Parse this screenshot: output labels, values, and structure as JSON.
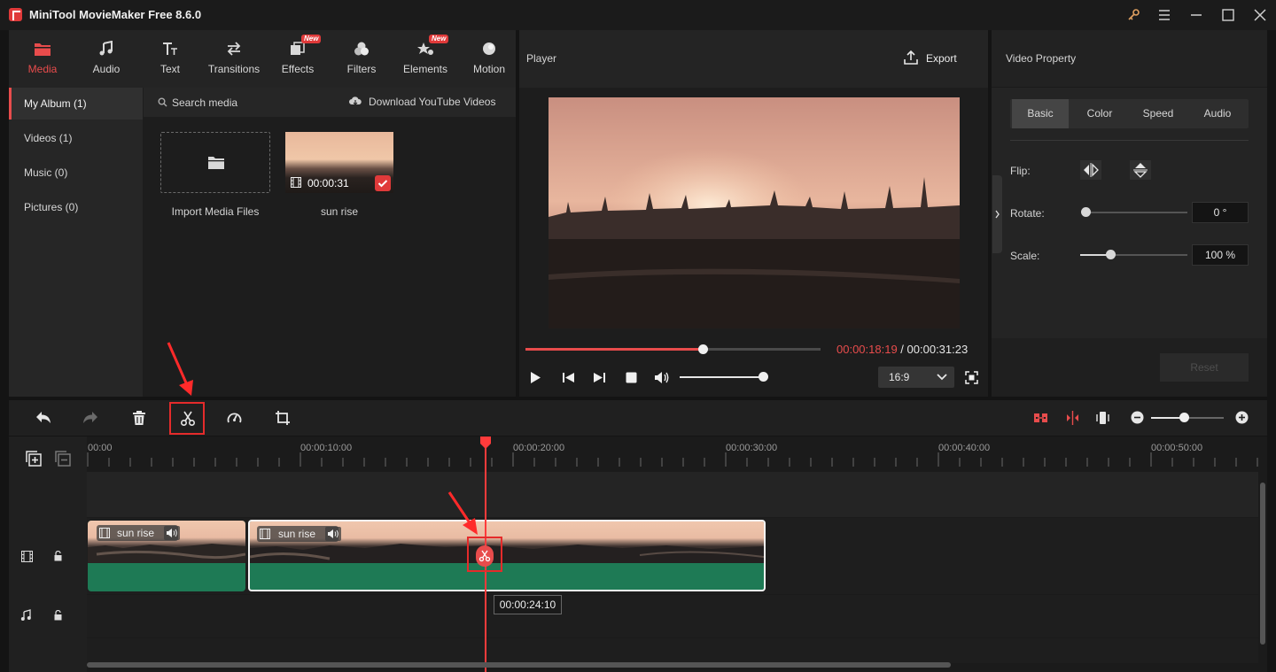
{
  "app": {
    "title": "MiniTool MovieMaker Free 8.6.0"
  },
  "tabs": [
    {
      "label": "Media",
      "icon": "folder-icon",
      "new": false
    },
    {
      "label": "Audio",
      "icon": "music-note-icon",
      "new": false
    },
    {
      "label": "Text",
      "icon": "text-icon",
      "new": false
    },
    {
      "label": "Transitions",
      "icon": "transitions-icon",
      "new": false
    },
    {
      "label": "Effects",
      "icon": "effects-icon",
      "new": true
    },
    {
      "label": "Filters",
      "icon": "filters-icon",
      "new": false
    },
    {
      "label": "Elements",
      "icon": "elements-icon",
      "new": true
    },
    {
      "label": "Motion",
      "icon": "motion-icon",
      "new": false
    }
  ],
  "badge_new": "New",
  "sidebar": {
    "items": [
      "My Album (1)",
      "Videos (1)",
      "Music (0)",
      "Pictures (0)"
    ]
  },
  "media": {
    "search_placeholder": "Search media",
    "download_label": "Download YouTube Videos",
    "import_label": "Import Media Files",
    "clip_name": "sun rise",
    "clip_duration": "00:00:31"
  },
  "player": {
    "title": "Player",
    "export_label": "Export",
    "current_time": "00:00:18:19",
    "separator": " / ",
    "total_time": "00:00:31:23",
    "progress": 0.6,
    "volume": 1.0,
    "aspect_ratio": "16:9"
  },
  "property": {
    "title": "Video Property",
    "tabs": [
      "Basic",
      "Color",
      "Speed",
      "Audio"
    ],
    "flip_label": "Flip:",
    "rotate_label": "Rotate:",
    "rotate_value": "0 °",
    "rotate_level": 0.0,
    "scale_label": "Scale:",
    "scale_value": "100 %",
    "scale_level": 0.28,
    "reset_label": "Reset"
  },
  "timeline": {
    "ruler_labels": [
      "00:00",
      "00:00:10:00",
      "00:00:20:00",
      "00:00:30:00",
      "00:00:40:00",
      "00:00:50:00"
    ],
    "clip1_name": "sun rise",
    "clip2_name": "sun rise",
    "tooltip_time": "00:00:24:10",
    "zoom_level": 0.45
  },
  "colors": {
    "accent": "#e84c4c",
    "clip_green": "#1e7a55",
    "playhead": "#ff3b3b"
  }
}
